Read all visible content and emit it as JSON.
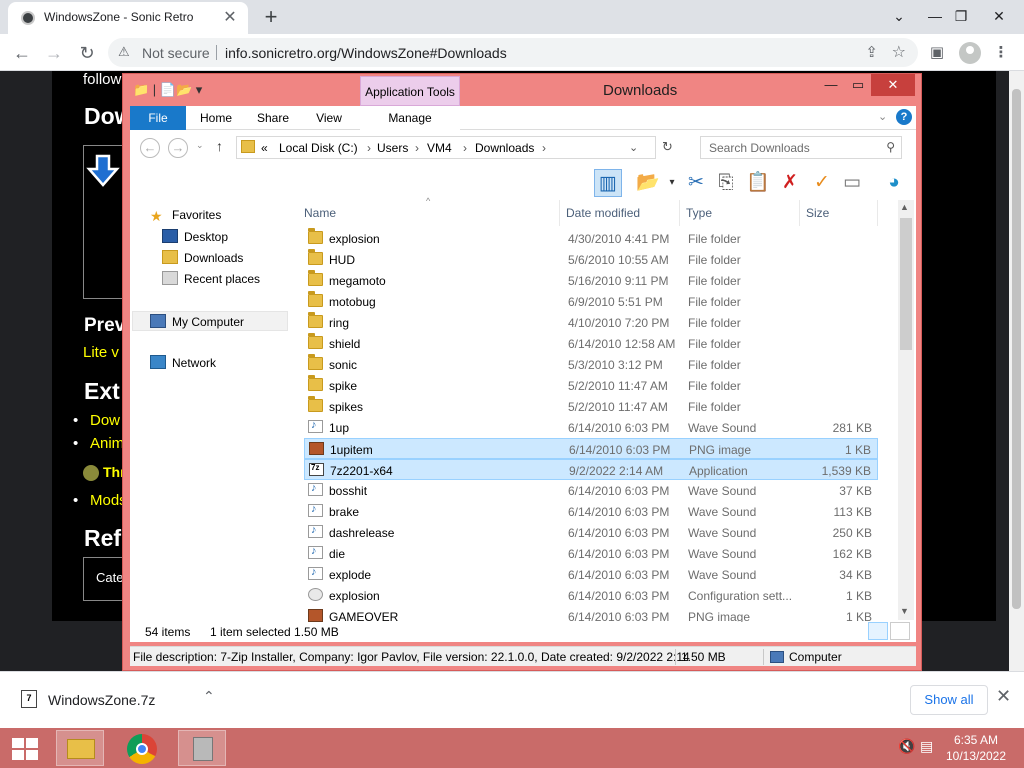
{
  "browser": {
    "tab_title": "WindowsZone - Sonic Retro",
    "security_label": "Not secure",
    "url": "info.sonicretro.org/WindowsZone#Downloads"
  },
  "webpage": {
    "line_fragment": "follow",
    "heading_download": "Dow",
    "heading_preview": "Prev",
    "lite_text": "Lite v",
    "heading_extras": "Ext",
    "bullets": [
      "Dow",
      "Anim",
      "Thr",
      "Mods"
    ],
    "heading_refs": "Ref",
    "category_text": "Cate"
  },
  "explorer": {
    "window_title": "Downloads",
    "contextual_tab": "Application Tools",
    "ribbon_tabs": [
      "File",
      "Home",
      "Share",
      "View",
      "Manage"
    ],
    "breadcrumbs": [
      "«",
      "Local Disk (C:)",
      "Users",
      "VM4",
      "Downloads"
    ],
    "search_placeholder": "Search Downloads",
    "nav": {
      "favorites": "Favorites",
      "desktop": "Desktop",
      "downloads": "Downloads",
      "recent": "Recent places",
      "my_computer": "My Computer",
      "network": "Network"
    },
    "columns": [
      "Name",
      "Date modified",
      "Type",
      "Size"
    ],
    "files": [
      {
        "name": "explosion",
        "date": "4/30/2010 4:41 PM",
        "type": "File folder",
        "size": "",
        "icon": "folder"
      },
      {
        "name": "HUD",
        "date": "5/6/2010 10:55 AM",
        "type": "File folder",
        "size": "",
        "icon": "folder"
      },
      {
        "name": "megamoto",
        "date": "5/16/2010 9:11 PM",
        "type": "File folder",
        "size": "",
        "icon": "folder"
      },
      {
        "name": "motobug",
        "date": "6/9/2010 5:51 PM",
        "type": "File folder",
        "size": "",
        "icon": "folder"
      },
      {
        "name": "ring",
        "date": "4/10/2010 7:20 PM",
        "type": "File folder",
        "size": "",
        "icon": "folder"
      },
      {
        "name": "shield",
        "date": "6/14/2010 12:58 AM",
        "type": "File folder",
        "size": "",
        "icon": "folder"
      },
      {
        "name": "sonic",
        "date": "5/3/2010 3:12 PM",
        "type": "File folder",
        "size": "",
        "icon": "folder"
      },
      {
        "name": "spike",
        "date": "5/2/2010 11:47 AM",
        "type": "File folder",
        "size": "",
        "icon": "folder"
      },
      {
        "name": "spikes",
        "date": "5/2/2010 11:47 AM",
        "type": "File folder",
        "size": "",
        "icon": "folder"
      },
      {
        "name": "1up",
        "date": "6/14/2010 6:03 PM",
        "type": "Wave Sound",
        "size": "281 KB",
        "icon": "wave"
      },
      {
        "name": "1upitem",
        "date": "6/14/2010 6:03 PM",
        "type": "PNG image",
        "size": "1 KB",
        "icon": "png"
      },
      {
        "name": "7z2201-x64",
        "date": "9/2/2022 2:14 AM",
        "type": "Application",
        "size": "1,539 KB",
        "icon": "app"
      },
      {
        "name": "bosshit",
        "date": "6/14/2010 6:03 PM",
        "type": "Wave Sound",
        "size": "37 KB",
        "icon": "wave"
      },
      {
        "name": "brake",
        "date": "6/14/2010 6:03 PM",
        "type": "Wave Sound",
        "size": "113 KB",
        "icon": "wave"
      },
      {
        "name": "dashrelease",
        "date": "6/14/2010 6:03 PM",
        "type": "Wave Sound",
        "size": "250 KB",
        "icon": "wave"
      },
      {
        "name": "die",
        "date": "6/14/2010 6:03 PM",
        "type": "Wave Sound",
        "size": "162 KB",
        "icon": "wave"
      },
      {
        "name": "explode",
        "date": "6/14/2010 6:03 PM",
        "type": "Wave Sound",
        "size": "34 KB",
        "icon": "wave"
      },
      {
        "name": "explosion",
        "date": "6/14/2010 6:03 PM",
        "type": "Configuration sett...",
        "size": "1 KB",
        "icon": "cfg"
      },
      {
        "name": "GAMEOVER",
        "date": "6/14/2010 6:03 PM",
        "type": "PNG image",
        "size": "1 KB",
        "icon": "png"
      }
    ],
    "status_items": "54 items",
    "status_selected": "1 item selected  1.50 MB",
    "details_description": "File description: 7-Zip Installer, Company: Igor Pavlov, File version: 22.1.0.0, Date created: 9/2/2022 2:14",
    "details_size": "1.50 MB",
    "details_location": "Computer"
  },
  "download_bar": {
    "filename": "WindowsZone.7z",
    "show_all": "Show all"
  },
  "taskbar": {
    "time": "6:35 AM",
    "date": "10/13/2022"
  },
  "colors": {
    "explorer_frame": "#f08583",
    "taskbar": "#c96b69",
    "selection": "#cce8ff",
    "file_tab": "#1979ca"
  }
}
